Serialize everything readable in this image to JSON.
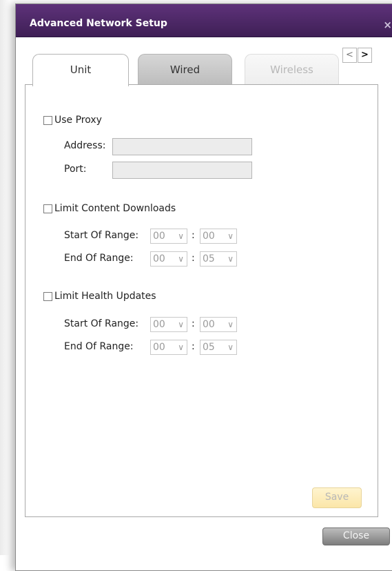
{
  "dialog": {
    "title": "Advanced Network Setup",
    "close_glyph": "×"
  },
  "tabs": [
    {
      "label": "Unit",
      "state": "active"
    },
    {
      "label": "Wired",
      "state": "inactive"
    },
    {
      "label": "Wireless",
      "state": "disabled"
    }
  ],
  "tab_nav": {
    "prev": "<",
    "next": ">"
  },
  "proxy": {
    "checkbox_label": "Use Proxy",
    "checked": false,
    "address_label": "Address:",
    "address_value": "",
    "port_label": "Port:",
    "port_value": ""
  },
  "content_downloads": {
    "checkbox_label": "Limit Content Downloads",
    "checked": false,
    "start_label": "Start Of Range:",
    "start_hour": "00",
    "start_minute": "00",
    "end_label": "End Of Range:",
    "end_hour": "00",
    "end_minute": "05"
  },
  "health_updates": {
    "checkbox_label": "Limit Health Updates",
    "checked": false,
    "start_label": "Start Of Range:",
    "start_hour": "00",
    "start_minute": "00",
    "end_label": "End Of Range:",
    "end_hour": "00",
    "end_minute": "05"
  },
  "separator": ":",
  "dropdown_caret": "∨",
  "buttons": {
    "save": "Save",
    "close": "Close"
  },
  "colors": {
    "titlebar": "#4b2766",
    "save_button": "#fbe6a8",
    "close_button": "#8e8e8e"
  }
}
